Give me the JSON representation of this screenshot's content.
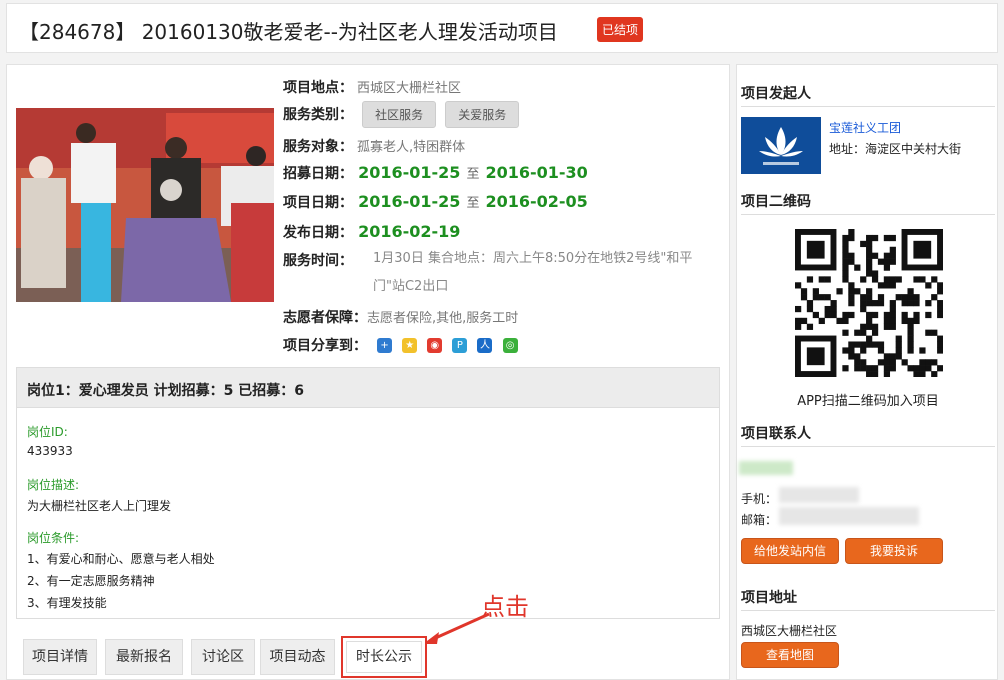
{
  "project": {
    "title": "【284678】 20160130敬老爱老--为社区老人理发活动项目",
    "status_badge": "已结项"
  },
  "info": {
    "location_label": "项目地点：",
    "location_value": "西城区大栅栏社区",
    "category_label": "服务类别：",
    "categories": [
      "社区服务",
      "关爱服务"
    ],
    "target_label": "服务对象：",
    "target_value": "孤寡老人,特困群体",
    "recruit_label": "招募日期：",
    "recruit_start": "2016-01-25",
    "recruit_end": "2016-01-30",
    "project_date_label": "项目日期：",
    "project_start": "2016-01-25",
    "project_end": "2016-02-05",
    "publish_label": "发布日期：",
    "publish_date": "2016-02-19",
    "to_word": "至",
    "service_time_label": "服务时间：",
    "service_time_value": "1月30日 集合地点：周六上午8:50分在地铁2号线\"和平门\"站C2出口",
    "guarantee_label": "志愿者保障：",
    "guarantee_value": "志愿者保险,其他,服务工时",
    "share_label": "项目分享到："
  },
  "post": {
    "header": "岗位1：爱心理发员   计划招募：5   已招募：6",
    "id_label": "岗位ID:",
    "id_value": "433933",
    "desc_label": "岗位描述:",
    "desc_value": "为大栅栏社区老人上门理发",
    "cond_label": "岗位条件:",
    "conditions": [
      "1、有爱心和耐心、愿意与老人相处",
      "2、有一定志愿服务精神",
      "3、有理发技能"
    ]
  },
  "tabs": [
    "项目详情",
    "最新报名",
    "讨论区",
    "项目动态",
    "时长公示"
  ],
  "annotation": "点击",
  "sidebar": {
    "initiator_title": "项目发起人",
    "org_name": "宝莲社义工团",
    "org_addr": "地址：海淀区中关村大街",
    "qr_title": "项目二维码",
    "qr_caption": "APP扫描二维码加入项目",
    "contact_title": "项目联系人",
    "phone_label": "手机：",
    "email_label": "邮箱：",
    "msg_button": "给他发站内信",
    "complain_button": "我要投诉",
    "address_title": "项目地址",
    "address_value": "西城区大栅栏社区",
    "map_button": "查看地图"
  },
  "colors": {
    "accent": "#e0362b",
    "date_green": "#1d8f20",
    "button_orange": "#e8671d"
  }
}
